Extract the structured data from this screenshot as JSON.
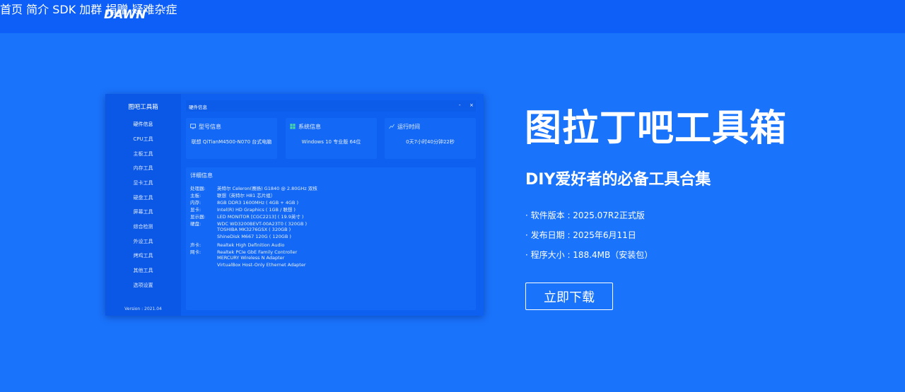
{
  "header": {
    "logo_text": "DAWN",
    "nav": [
      "首页",
      "简介",
      "SDK",
      "加群",
      "捐赠",
      "疑难杂症"
    ]
  },
  "app_preview": {
    "brand": "图吧工具箱",
    "menu": [
      "硬件信息",
      "CPU工具",
      "主板工具",
      "内存工具",
      "显卡工具",
      "硬盘工具",
      "屏幕工具",
      "综合检测",
      "外设工具",
      "烤鸡工具",
      "其他工具",
      "选项设置"
    ],
    "version": "Version : 2021.04",
    "window_title": "硬件信息",
    "min_symbol": "-",
    "close_symbol": "×",
    "cards": [
      {
        "title": "型号信息",
        "value": "联想 QiTianM4500-N070 台式电脑"
      },
      {
        "title": "系统信息",
        "value": "Windows 10 专业版 64位"
      },
      {
        "title": "运行时间",
        "value": "0天7小时40分钟22秒"
      }
    ],
    "detail_title": "详细信息",
    "details": [
      {
        "k": "处理器:",
        "v": "英特尔 Celeron(赛扬) G1840 @ 2.80GHz 双核"
      },
      {
        "k": "主板:",
        "v": "联想（英特尔 H81 芯片组）"
      },
      {
        "k": "内存:",
        "v": "8GB DDR3 1600MHz ( 4GB + 4GB )"
      },
      {
        "k": "显卡:",
        "v": "Intel(R) HD Graphics ( 1GB / 联想 )"
      },
      {
        "k": "显示器:",
        "v": "LED MONITOR [CGC2213] ( 19.9英寸 )"
      },
      {
        "k": "硬盘:",
        "v": "WDC WD3200BEVT-00A23T0 ( 320GB )"
      },
      {
        "k": "",
        "v": "TOSHIBA MK3276GSX ( 320GB )"
      },
      {
        "k": "",
        "v": "ShineDisk M667 120G ( 120GB )"
      },
      {
        "k": "声卡:",
        "v": "Realtek High Definition Audio"
      },
      {
        "k": "网卡:",
        "v": "Realtek PCIe GbE Family Controller"
      },
      {
        "k": "",
        "v": "MERCURY Wireless N Adapter"
      },
      {
        "k": "",
        "v": "VirtualBox Host-Only Ethernet Adapter"
      }
    ]
  },
  "hero": {
    "title": "图拉丁吧工具箱",
    "subtitle": "DIY爱好者的必备工具合集",
    "meta": [
      "· 软件版本 : 2025.07R2正式版",
      "· 发布日期 : 2025年6月11日",
      "· 程序大小 : 188.4MB（安装包）"
    ],
    "download_label": "立即下载"
  },
  "colors": {
    "page_bg": "#1a73fb",
    "header_bg": "#0d5ff7",
    "text": "#ffffff"
  }
}
